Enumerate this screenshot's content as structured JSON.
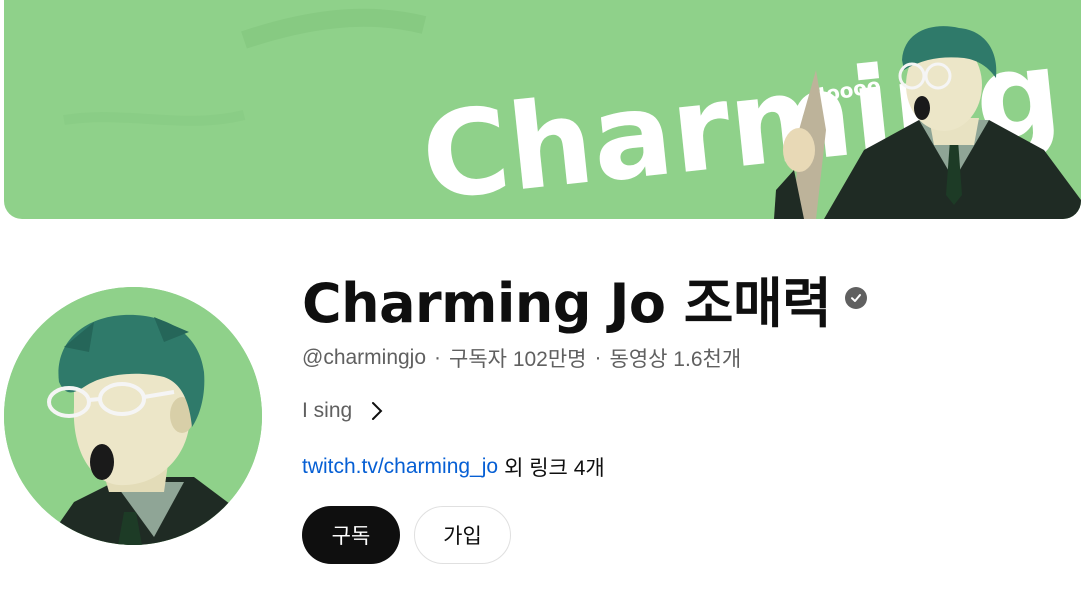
{
  "banner": {
    "logo_text_main": "Charming",
    "logo_text_small": "Joooo",
    "background_color": "#8fd18a"
  },
  "channel": {
    "title": "Charming Jo 조매력",
    "verified": true,
    "handle": "@charmingjo",
    "separator": "·",
    "subscribers": "구독자 102만명",
    "videos": "동영상 1.6천개",
    "description": "I sing",
    "link_text": "twitch.tv/charming_jo",
    "more_links": "외 링크 4개"
  },
  "actions": {
    "subscribe_label": "구독",
    "join_label": "가입"
  },
  "icons": {
    "verified": "verified-check-icon",
    "description_more": "chevron-right-icon"
  },
  "colors": {
    "accent_link": "#065fd4",
    "subscribe_bg": "#0f0f0f",
    "muted_text": "#606060"
  }
}
